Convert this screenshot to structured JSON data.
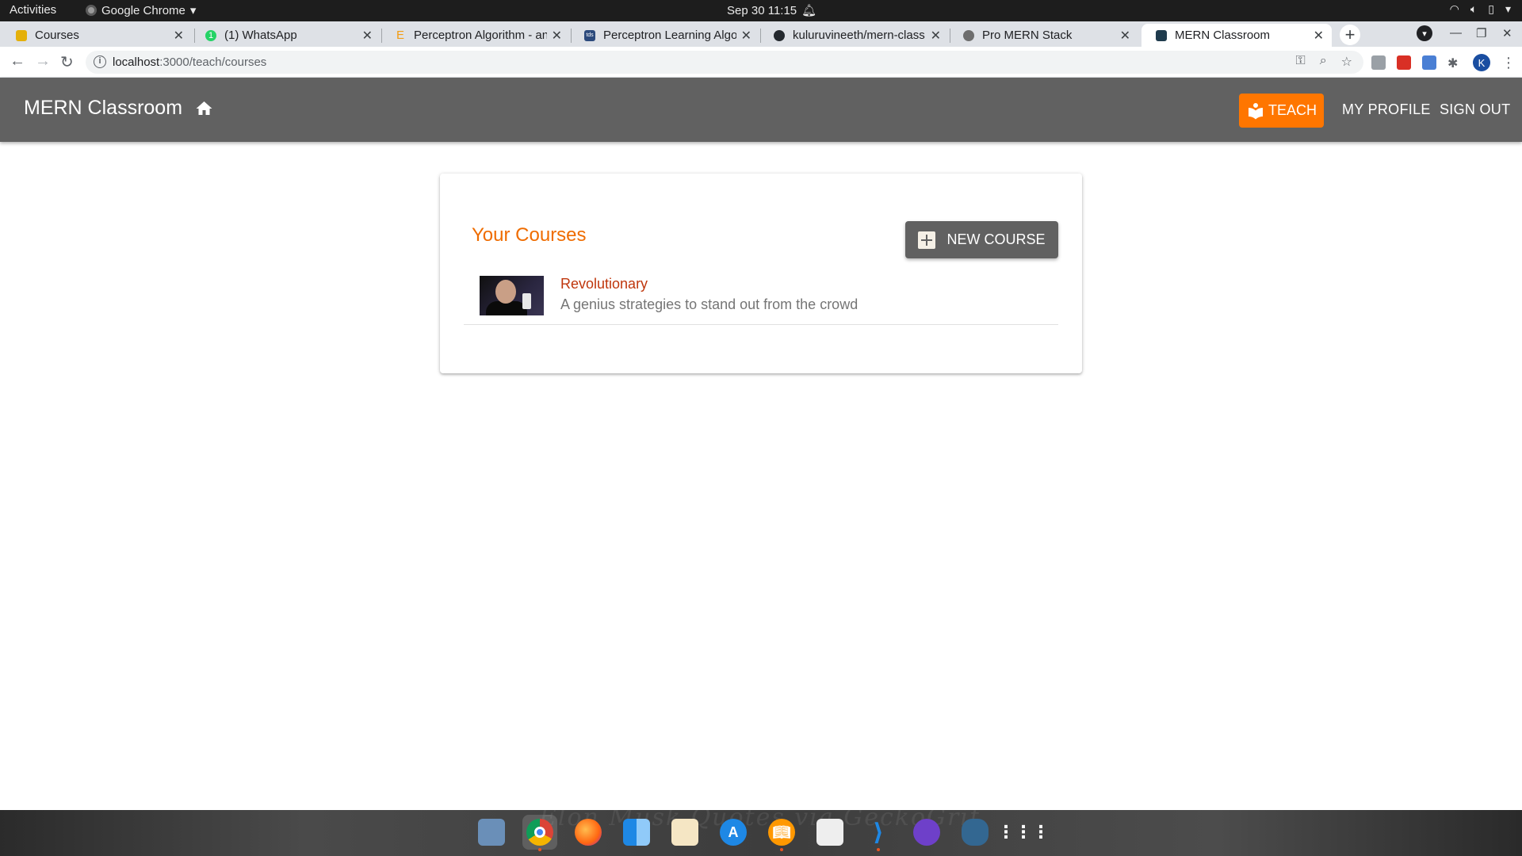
{
  "system_bar": {
    "activities": "Activities",
    "app_name": "Google Chrome",
    "clock": "Sep 30  11:15"
  },
  "browser": {
    "tabs": [
      {
        "title": "Courses",
        "favicon_color": "#e4b00a",
        "active": false
      },
      {
        "title": "(1) WhatsApp",
        "favicon_color": "#25d366",
        "active": false
      },
      {
        "title": "Perceptron Algorithm - an",
        "favicon_color": "#f39c12",
        "active": false
      },
      {
        "title": "Perceptron Learning Algo",
        "favicon_color": "#2c4a7c",
        "active": false
      },
      {
        "title": "kuluruvineeth/mern-class",
        "favicon_color": "#24292e",
        "active": false
      },
      {
        "title": "Pro MERN Stack",
        "favicon_color": "#6d6d6d",
        "active": false
      },
      {
        "title": "MERN Classroom",
        "favicon_color": "#1f3b4d",
        "active": true
      }
    ],
    "url_host": "localhost",
    "url_rest": ":3000/teach/courses",
    "profile_initial": "K"
  },
  "app": {
    "title": "MERN Classroom",
    "nav": {
      "teach": "TEACH",
      "my_profile": "MY PROFILE",
      "sign_out": "SIGN OUT"
    },
    "accent_color": "#ff7600"
  },
  "courses_card": {
    "title": "Your Courses",
    "new_course_label": "NEW COURSE",
    "courses": [
      {
        "name": "Revolutionary",
        "description": "A genius strategies to stand out from the crowd"
      }
    ]
  },
  "dock": {
    "watermark": "Elon Musk Quotes via GeckoGrif",
    "apps": [
      "preview",
      "chrome",
      "firefox",
      "finder",
      "textedit",
      "app-store",
      "books",
      "notes",
      "vscode",
      "github",
      "postgres",
      "app-grid"
    ]
  }
}
